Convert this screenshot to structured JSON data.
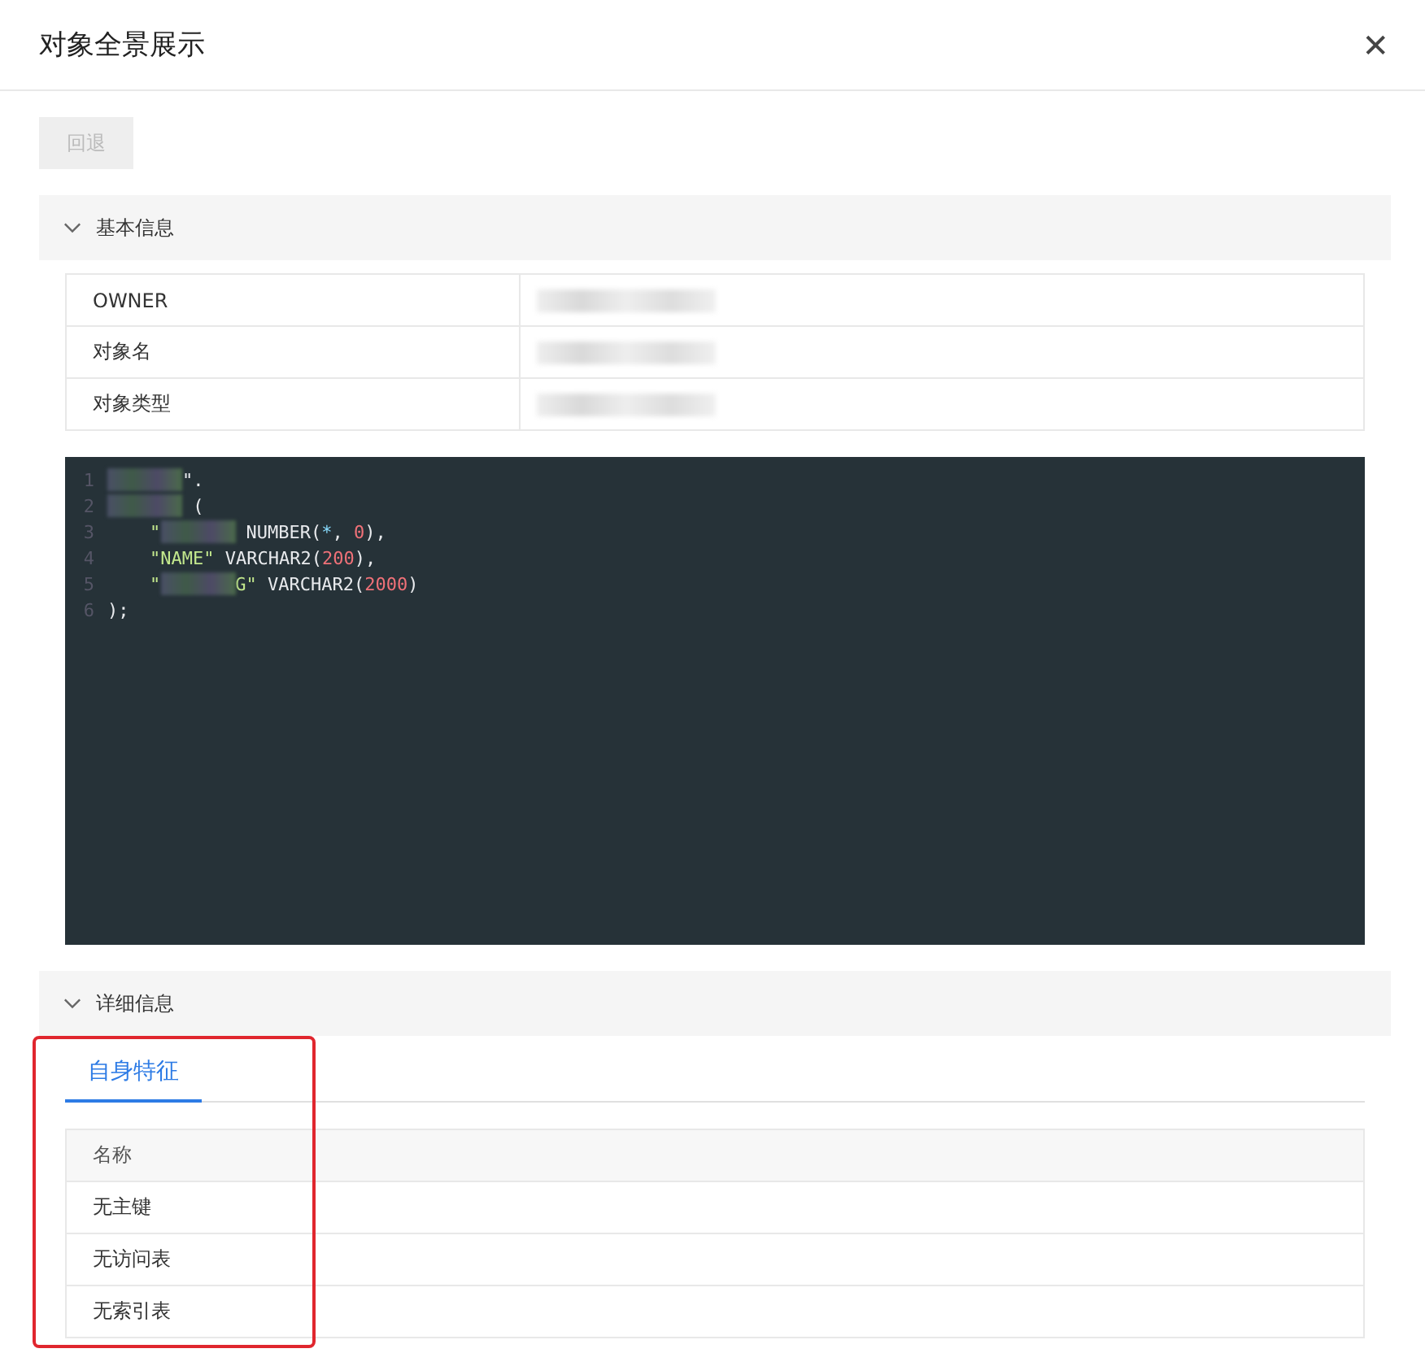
{
  "dialog": {
    "title": "对象全景展示",
    "close": "✕"
  },
  "back_button": {
    "label": "回退",
    "disabled": true
  },
  "basic_section": {
    "title": "基本信息",
    "expanded": true,
    "rows": [
      {
        "label": "OWNER",
        "redacted": true
      },
      {
        "label": "对象名",
        "redacted": true
      },
      {
        "label": "对象类型",
        "redacted": true
      }
    ],
    "code": [
      {
        "number": "1",
        "indented": false,
        "tokens": [
          {
            "kind": "redacted"
          },
          {
            "kind": "plain",
            "text": "\"."
          }
        ]
      },
      {
        "number": "2",
        "indented": false,
        "tokens": [
          {
            "kind": "redacted"
          },
          {
            "kind": "plain",
            "text": " ("
          }
        ]
      },
      {
        "number": "3",
        "indented": true,
        "tokens": [
          {
            "kind": "string",
            "text": "\""
          },
          {
            "kind": "redacted"
          },
          {
            "kind": "plain",
            "text": " NUMBER("
          },
          {
            "kind": "operator",
            "text": "*"
          },
          {
            "kind": "plain",
            "text": ", "
          },
          {
            "kind": "number",
            "text": "0"
          },
          {
            "kind": "plain",
            "text": "),"
          }
        ]
      },
      {
        "number": "4",
        "indented": true,
        "tokens": [
          {
            "kind": "string",
            "text": "\"NAME\""
          },
          {
            "kind": "plain",
            "text": " VARCHAR2("
          },
          {
            "kind": "number",
            "text": "200"
          },
          {
            "kind": "plain",
            "text": "),"
          }
        ]
      },
      {
        "number": "5",
        "indented": true,
        "tokens": [
          {
            "kind": "string",
            "text": "\""
          },
          {
            "kind": "redacted"
          },
          {
            "kind": "string",
            "text": "G\""
          },
          {
            "kind": "plain",
            "text": " VARCHAR2("
          },
          {
            "kind": "number",
            "text": "2000"
          },
          {
            "kind": "plain",
            "text": ")"
          }
        ]
      },
      {
        "number": "6",
        "indented": false,
        "tokens": [
          {
            "kind": "plain",
            "text": ");"
          }
        ]
      }
    ]
  },
  "detail_section": {
    "title": "详细信息",
    "expanded": true,
    "tabs": [
      {
        "label": "自身特征",
        "selected": true
      }
    ],
    "table": {
      "columns": [
        "名称"
      ],
      "rows": [
        [
          "无主键"
        ],
        [
          "无访问表"
        ],
        [
          "无索引表"
        ]
      ]
    },
    "highlighted": true
  }
}
